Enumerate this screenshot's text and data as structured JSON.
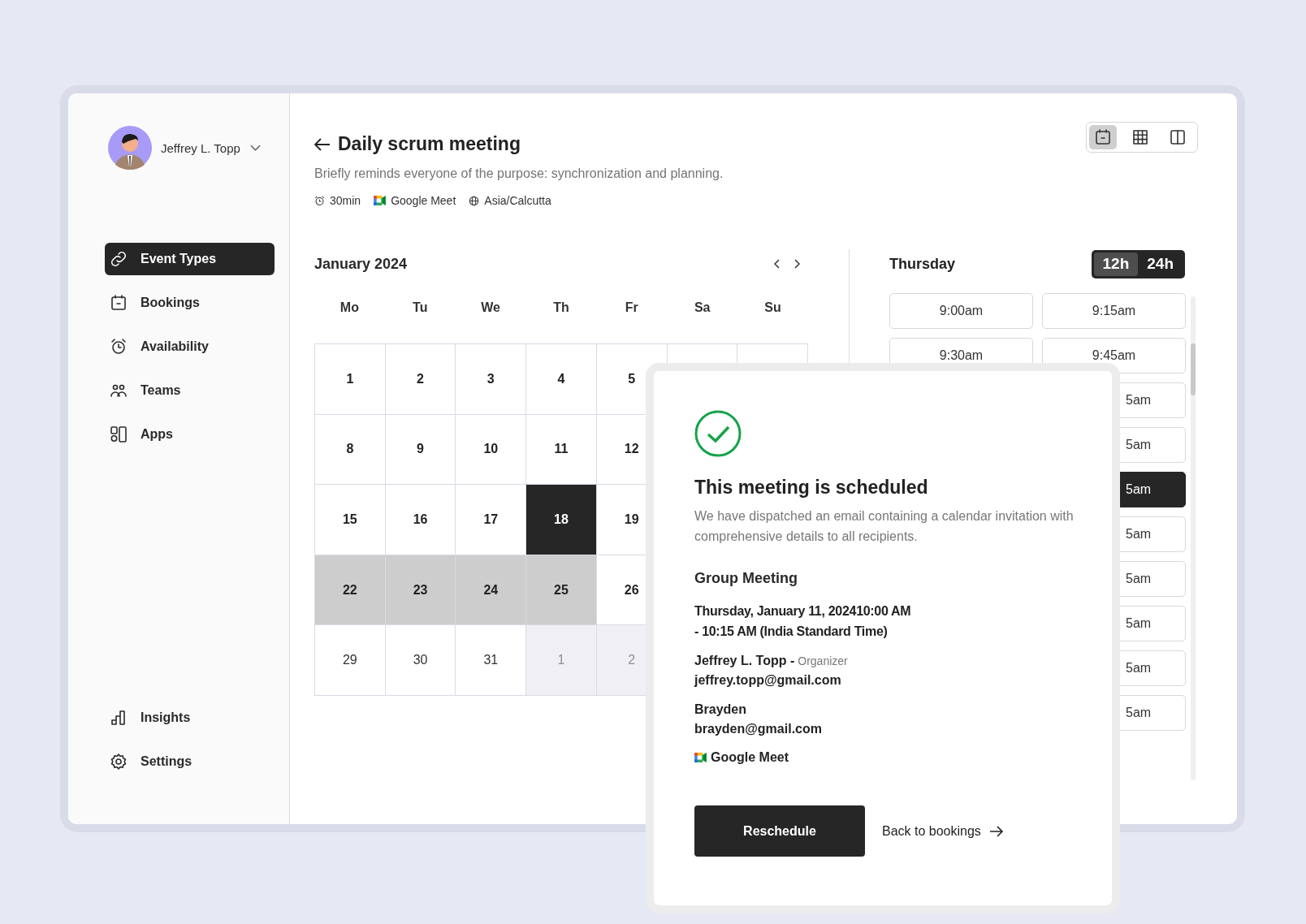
{
  "user": {
    "name": "Jeffrey L. Topp"
  },
  "nav": [
    {
      "label": "Event Types",
      "selected": true
    },
    {
      "label": "Bookings",
      "selected": false
    },
    {
      "label": "Availability",
      "selected": false
    },
    {
      "label": "Teams",
      "selected": false
    },
    {
      "label": "Apps",
      "selected": false
    }
  ],
  "nav_bottom": [
    {
      "label": "Insights",
      "selected": false
    },
    {
      "label": "Settings",
      "selected": false
    }
  ],
  "event": {
    "title": "Daily scrum meeting",
    "description": "Briefly reminds everyone of the purpose: synchronization and planning.",
    "meta": [
      "30min",
      "Google Meet",
      "Asia/Calcutta"
    ]
  },
  "view_switcher": [
    {
      "selected": true
    },
    {
      "selected": false
    },
    {
      "selected": false
    }
  ],
  "calendar": {
    "month": "January 2024",
    "weekdays": [
      "Mo",
      "Tu",
      "We",
      "Th",
      "Fr",
      "Sa",
      "Su"
    ],
    "weeks": [
      [
        {
          "label": "1",
          "kind": "normal",
          "available": true,
          "selected": false
        },
        {
          "label": "2",
          "kind": "normal",
          "available": true,
          "selected": false
        },
        {
          "label": "3",
          "kind": "normal",
          "available": true,
          "selected": false
        },
        {
          "label": "4",
          "kind": "normal",
          "available": true,
          "selected": false
        },
        {
          "label": "5",
          "kind": "normal",
          "available": true,
          "selected": false
        }
      ],
      [
        {
          "label": "8",
          "kind": "normal",
          "available": true,
          "selected": false
        },
        {
          "label": "9",
          "kind": "normal",
          "available": true,
          "selected": false
        },
        {
          "label": "10",
          "kind": "normal",
          "available": true,
          "selected": false
        },
        {
          "label": "11",
          "kind": "normal",
          "available": true,
          "selected": false
        },
        {
          "label": "12",
          "kind": "normal",
          "available": true,
          "selected": false
        }
      ],
      [
        {
          "label": "15",
          "kind": "normal",
          "available": true,
          "selected": false
        },
        {
          "label": "16",
          "kind": "normal",
          "available": true,
          "selected": false
        },
        {
          "label": "17",
          "kind": "normal",
          "available": true,
          "selected": false
        },
        {
          "label": "18",
          "kind": "normal",
          "available": true,
          "selected": true
        },
        {
          "label": "19",
          "kind": "normal",
          "available": true,
          "selected": false
        }
      ],
      [
        {
          "label": "22",
          "kind": "range",
          "available": true,
          "selected": false
        },
        {
          "label": "23",
          "kind": "range",
          "available": true,
          "selected": false
        },
        {
          "label": "24",
          "kind": "range",
          "available": true,
          "selected": false
        },
        {
          "label": "25",
          "kind": "range",
          "available": true,
          "selected": false
        },
        {
          "label": "26",
          "kind": "normal",
          "available": true,
          "selected": false
        }
      ],
      [
        {
          "label": "29",
          "kind": "normal",
          "available": false,
          "selected": false
        },
        {
          "label": "30",
          "kind": "normal",
          "available": false,
          "selected": false
        },
        {
          "label": "31",
          "kind": "normal",
          "available": false,
          "selected": false
        },
        {
          "label": "1",
          "kind": "other_month",
          "available": false,
          "selected": false
        },
        {
          "label": "2",
          "kind": "other_month",
          "available": false,
          "selected": false
        }
      ]
    ]
  },
  "day_panel": {
    "day": "Thursday",
    "formats": [
      {
        "label": "12h",
        "selected": true
      },
      {
        "label": "24h",
        "selected": false
      }
    ],
    "slots": [
      {
        "label": "9:00am",
        "kind": "full",
        "selected": false
      },
      {
        "label": "9:15am",
        "kind": "full",
        "selected": false
      },
      {
        "label": "9:30am",
        "kind": "full",
        "selected": false
      },
      {
        "label": "9:45am",
        "kind": "full",
        "selected": false
      },
      {
        "label": "5am",
        "kind": "partial",
        "selected": false
      },
      {
        "label": "5am",
        "kind": "partial",
        "selected": false
      },
      {
        "label": "5am",
        "kind": "partial",
        "selected": true
      },
      {
        "label": "5am",
        "kind": "partial",
        "selected": false
      },
      {
        "label": "5am",
        "kind": "partial",
        "selected": false
      },
      {
        "label": "5am",
        "kind": "partial",
        "selected": false
      },
      {
        "label": "5am",
        "kind": "partial",
        "selected": false
      },
      {
        "label": "5am",
        "kind": "partial",
        "selected": false
      }
    ]
  },
  "dialog": {
    "title": "This meeting is scheduled",
    "message": "We have dispatched an email containing a calendar invitation with comprehensive details to all recipients.",
    "event_name": "Group Meeting",
    "when": "Thursday, January 11, 202410:00 AM - 10:15 AM (India Standard Time)",
    "attendees": [
      {
        "name": "Jeffrey L. Topp -",
        "role": "Organizer",
        "email": "jeffrey.topp@gmail.com"
      },
      {
        "name": "Brayden",
        "email": "brayden@gmail.com"
      }
    ],
    "location": "Google Meet",
    "primary_button": "Reschedule",
    "secondary_link": "Back to bookings"
  }
}
